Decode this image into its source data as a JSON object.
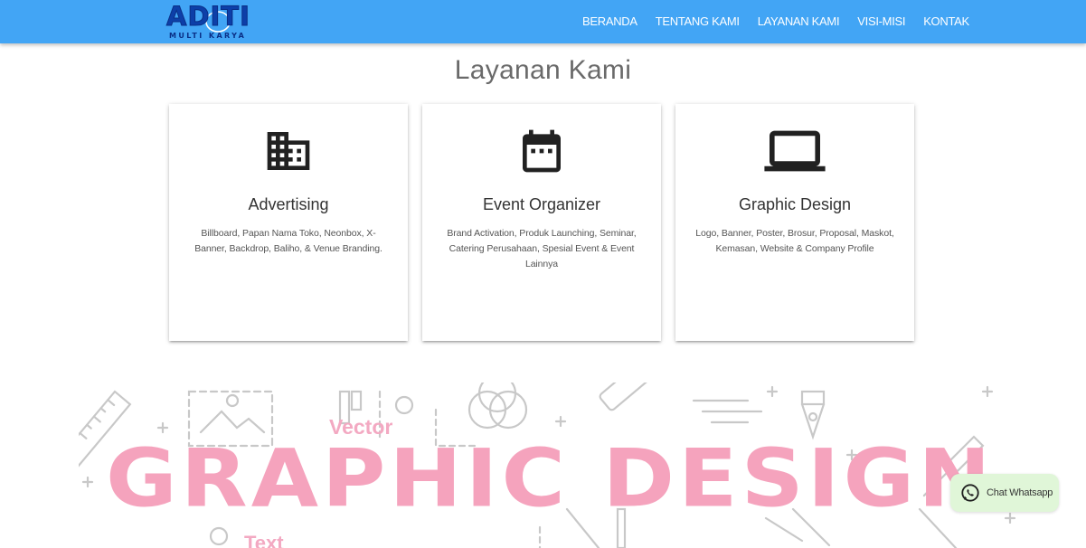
{
  "brand": {
    "logo_main": "ADITI",
    "logo_sub": "MULTI KARYA"
  },
  "nav": {
    "items": [
      {
        "label": "BERANDA"
      },
      {
        "label": "TENTANG KAMI"
      },
      {
        "label": "LAYANAN KAMI"
      },
      {
        "label": "VISI-MISI"
      },
      {
        "label": "KONTAK"
      }
    ]
  },
  "services": {
    "title": "Layanan Kami",
    "cards": [
      {
        "icon": "building-icon",
        "title": "Advertising",
        "description": "Billboard, Papan Nama Toko, Neonbox, X-Banner, Backdrop, Baliho, & Venue Branding."
      },
      {
        "icon": "calendar-icon",
        "title": "Event Organizer",
        "description": "Brand Activation, Produk Launching, Seminar, Catering Perusahaan, Spesial Event & Event Lainnya"
      },
      {
        "icon": "laptop-icon",
        "title": "Graphic Design",
        "description": "Logo, Banner, Poster, Brosur, Proposal, Maskot, Kemasan, Website & Company Profile"
      }
    ]
  },
  "banner": {
    "small_word": "Vector",
    "headline": "GRAPHIC DESIGN",
    "bottom_word": "Text"
  },
  "whatsapp": {
    "label": "Chat Whatsapp"
  },
  "colors": {
    "nav_bg": "#42a5f5",
    "logo_blue": "#0d3fa8",
    "banner_pink": "#f5a3bd",
    "whatsapp_bg": "#e0f6d8"
  }
}
